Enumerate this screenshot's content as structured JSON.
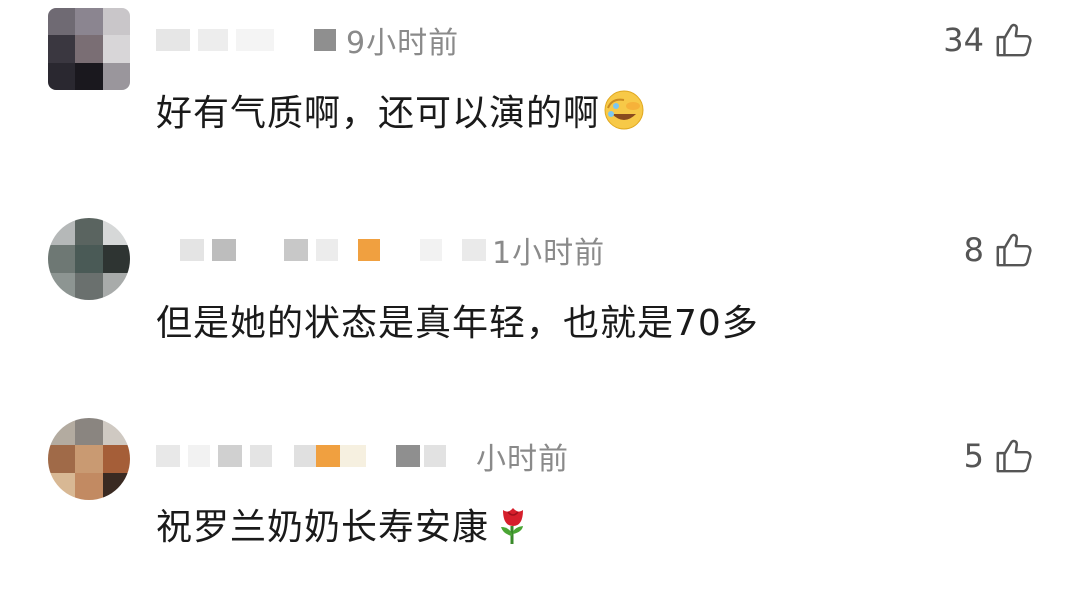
{
  "comments": [
    {
      "time": "9小时前",
      "likes": "34",
      "text": "好有气质啊，还可以演的啊",
      "emoji": "facepalm-laugh-emoji"
    },
    {
      "time": "1小时前",
      "likes": "8",
      "text": "但是她的状态是真年轻，也就是70多",
      "emoji": ""
    },
    {
      "time": "小时前",
      "likes": "5",
      "text": "祝罗兰奶奶长寿安康",
      "emoji": "rose-emoji"
    }
  ],
  "colors": {
    "text": "#1a1a1a",
    "meta": "#8a8a8a",
    "like": "#555555",
    "badge_orange": "#f0a040"
  }
}
